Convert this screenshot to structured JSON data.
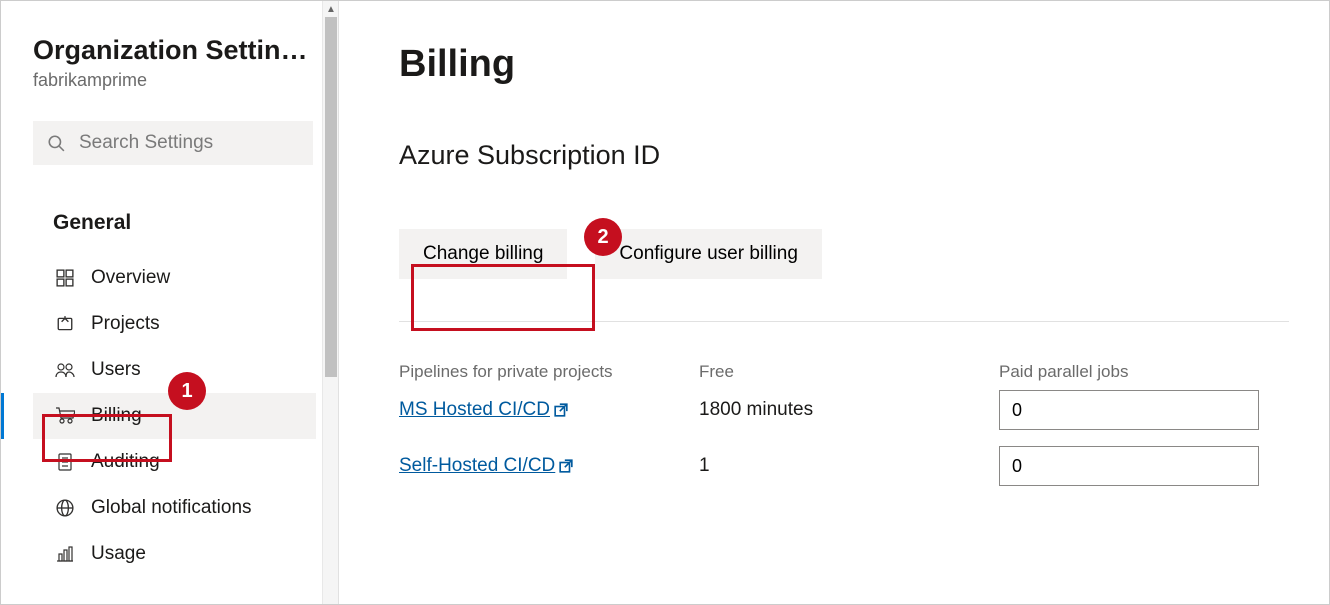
{
  "sidebar": {
    "title": "Organization Settin…",
    "subtitle": "fabrikamprime",
    "search_placeholder": "Search Settings",
    "section": "General",
    "items": [
      {
        "label": "Overview",
        "icon": "overview"
      },
      {
        "label": "Projects",
        "icon": "projects"
      },
      {
        "label": "Users",
        "icon": "users"
      },
      {
        "label": "Billing",
        "icon": "billing",
        "active": true
      },
      {
        "label": "Auditing",
        "icon": "auditing"
      },
      {
        "label": "Global notifications",
        "icon": "notifications"
      },
      {
        "label": "Usage",
        "icon": "usage"
      }
    ]
  },
  "annotations": {
    "one": "1",
    "two": "2"
  },
  "main": {
    "title": "Billing",
    "subtitle": "Azure Subscription ID",
    "buttons": {
      "change": "Change billing",
      "configure": "Configure user billing"
    },
    "table": {
      "headers": {
        "col1": "Pipelines for private projects",
        "col2": "Free",
        "col3": "Paid parallel jobs"
      },
      "rows": [
        {
          "name": "MS Hosted CI/CD",
          "free": "1800 minutes",
          "paid": "0"
        },
        {
          "name": "Self-Hosted CI/CD",
          "free": "1",
          "paid": "0"
        }
      ]
    }
  }
}
